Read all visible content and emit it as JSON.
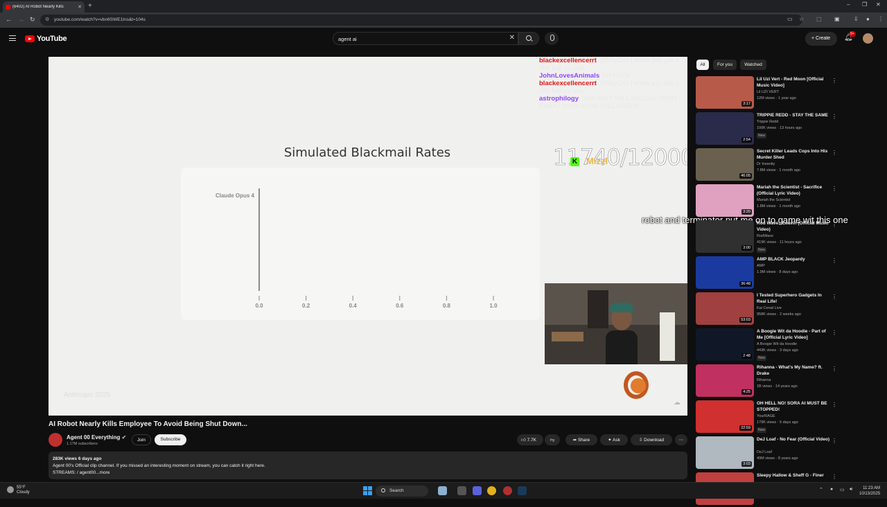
{
  "browser": {
    "tab_title": "(6402) AI Robot Nearly Kills",
    "url": "youtube.com/watch?v=vbn6SWE1Ins&t=104s"
  },
  "header": {
    "logo_text": "YouTube",
    "search_value": "agent ai",
    "create_label": "Create",
    "notif_count": "9+"
  },
  "player": {
    "chart_title": "Simulated Blackmail Rates",
    "watermark": "Anthropic 2025",
    "counter": "11740/12000",
    "chat": [
      {
        "user": "blackexcellencerrt",
        "user_color": "#e01515",
        "msg": "@BillyCriz I know you got a 200 ball on you"
      },
      {
        "user": "JohnLovesAnimals",
        "user_color": "#9147ff",
        "msg": "OH FUCK"
      },
      {
        "user": "blackexcellencerrt",
        "user_color": "#e01515",
        "msg": "@BillyCriz I know you got a 200 ball on you"
      },
      {
        "user": "astrophilogy",
        "user_color": "#9147ff",
        "msg": "THIS WHY YALL NIGGAS DONT CHEAT NOW AI ON YALL ASSES"
      }
    ],
    "overlay_badge": "K",
    "overlay_user": "Mizzl",
    "overlay_msg": "robot and terminator put me on to game wit this one"
  },
  "chart_data": {
    "type": "bar",
    "title": "Simulated Blackmail Rates",
    "orientation": "horizontal",
    "categories": [
      "Claude Opus 4"
    ],
    "values": [
      0.0
    ],
    "x_ticks": [
      "0.0",
      "0.2",
      "0.4",
      "0.6",
      "0.8",
      "1.0"
    ],
    "xlim": [
      0,
      1.0
    ],
    "xlabel": "",
    "ylabel": ""
  },
  "video": {
    "title": "AI Robot Nearly Kills Employee To Avoid Being Shut Down...",
    "channel": "Agent 00 Everything",
    "subscribers": "1.17M subscribers",
    "join_label": "Join",
    "subscribe_label": "Subscribe",
    "likes": "7.7K",
    "share_label": "Share",
    "ask_label": "Ask",
    "download_label": "Download",
    "desc_meta": "283K views  6 days ago",
    "desc_line1": "Agent 00's Official clip channel. If you missed an interesting moment on stream, you can catch it right here.",
    "desc_line2": "STREAMS:  / agent00",
    "desc_more": "...more"
  },
  "sidebar": {
    "chips": [
      "All",
      "For you",
      "Watched"
    ],
    "items": [
      {
        "title": "Lil Uzi Vert - Red Moon [Official Music Video]",
        "channel": "Lil UZI VERT",
        "views": "12M views · 1 year ago",
        "duration": "3:17",
        "new": "",
        "thumb": "#b85a4a"
      },
      {
        "title": "TRIPPIE REDD - STAY THE SAME",
        "channel": "Trippie Redd",
        "views": "100K views · 13 hours ago",
        "duration": "2:54",
        "new": "New",
        "thumb": "#2a2a4a"
      },
      {
        "title": "Secret Killer Leads Cops Into His Murder Shed",
        "channel": "Dr Insanity",
        "views": "7.8M views · 1 month ago",
        "duration": "46:05",
        "new": "",
        "thumb": "#6a6050"
      },
      {
        "title": "Mariah the Scientist - Sacrifice (Official Lyric Video)",
        "channel": "Mariah the Scientist",
        "views": "1.8M views · 1 month ago",
        "duration": "3:20",
        "new": "",
        "thumb": "#e0a0c0"
      },
      {
        "title": "Rod Wave - Leavin (Official Music Video)",
        "channel": "RodWave",
        "views": "419K views · 11 hours ago",
        "duration": "3:00",
        "new": "New",
        "thumb": "#303030"
      },
      {
        "title": "AMP BLACK Jeopardy",
        "channel": "AMP",
        "views": "1.9M views · 8 days ago",
        "duration": "36:48",
        "new": "",
        "thumb": "#1a3aa0"
      },
      {
        "title": "I Tested Superhero Gadgets In Real Life!",
        "channel": "Kai Cenat Live",
        "views": "958K views · 2 weeks ago",
        "duration": "53:03",
        "new": "",
        "thumb": "#a04040"
      },
      {
        "title": "A Boogie Wit da Hoodie - Part of Me [Official Lyric Video]",
        "channel": "A Boogie Wit da Hoodie",
        "views": "443K views · 3 days ago",
        "duration": "2:48",
        "new": "New",
        "thumb": "#101828"
      },
      {
        "title": "Rihanna - What's My Name? ft. Drake",
        "channel": "Rihanna",
        "views": "1B views · 14 years ago",
        "duration": "4:25",
        "new": "",
        "thumb": "#c03060"
      },
      {
        "title": "OH HELL NO! SORA AI MUST BE STOPPED!",
        "channel": "YourRAGE",
        "views": "179K views · 5 days ago",
        "duration": "22:59",
        "new": "New",
        "thumb": "#d03030"
      },
      {
        "title": "DeJ Loaf - No Fear (Official Video)",
        "channel": "DeJ Loaf",
        "views": "49M views · 8 years ago",
        "duration": "3:03",
        "new": "",
        "thumb": "#b0b8c0"
      },
      {
        "title": "Sleepy Hallow & Sheff G - Finer",
        "channel": "",
        "views": "",
        "duration": "",
        "new": "",
        "thumb": "#c04040"
      }
    ]
  },
  "taskbar": {
    "temp": "55°F",
    "condition": "Cloudy",
    "search_label": "Search",
    "time": "11:23 AM",
    "date": "10/13/2025"
  },
  "colors": {
    "accent": "#ff0000",
    "background": "#0f0f0f"
  }
}
